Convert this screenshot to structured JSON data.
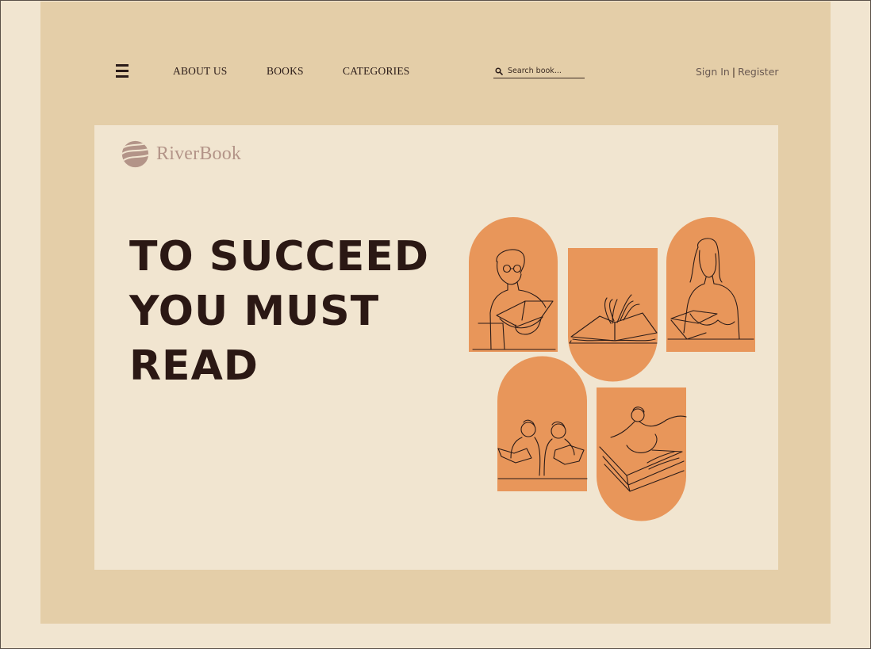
{
  "nav": {
    "menu_icon": "hamburger-menu-icon",
    "links": [
      "ABOUT US",
      "BOOKS",
      "CATEGORIES"
    ],
    "search_placeholder": "Search book...",
    "search_icon": "search-icon",
    "sign_in": "Sign In",
    "separator": "|",
    "register": "Register"
  },
  "brand": {
    "name": "RiverBook",
    "logo_icon": "river-wave-logo-icon"
  },
  "hero": {
    "headline_lines": [
      "TO SUCCEED",
      "YOU MUST",
      "READ"
    ]
  },
  "illustrations": [
    {
      "icon": "man-reading-book-icon"
    },
    {
      "icon": "open-book-icon"
    },
    {
      "icon": "woman-reading-book-icon"
    },
    {
      "icon": "kids-reading-books-icon"
    },
    {
      "icon": "person-on-giant-book-icon"
    }
  ],
  "colors": {
    "page_bg": "#F1E5D0",
    "frame_bg": "#E4CEA8",
    "panel_orange": "#E8965A",
    "heading_text": "#2B1814",
    "brand_text": "#B39488"
  }
}
